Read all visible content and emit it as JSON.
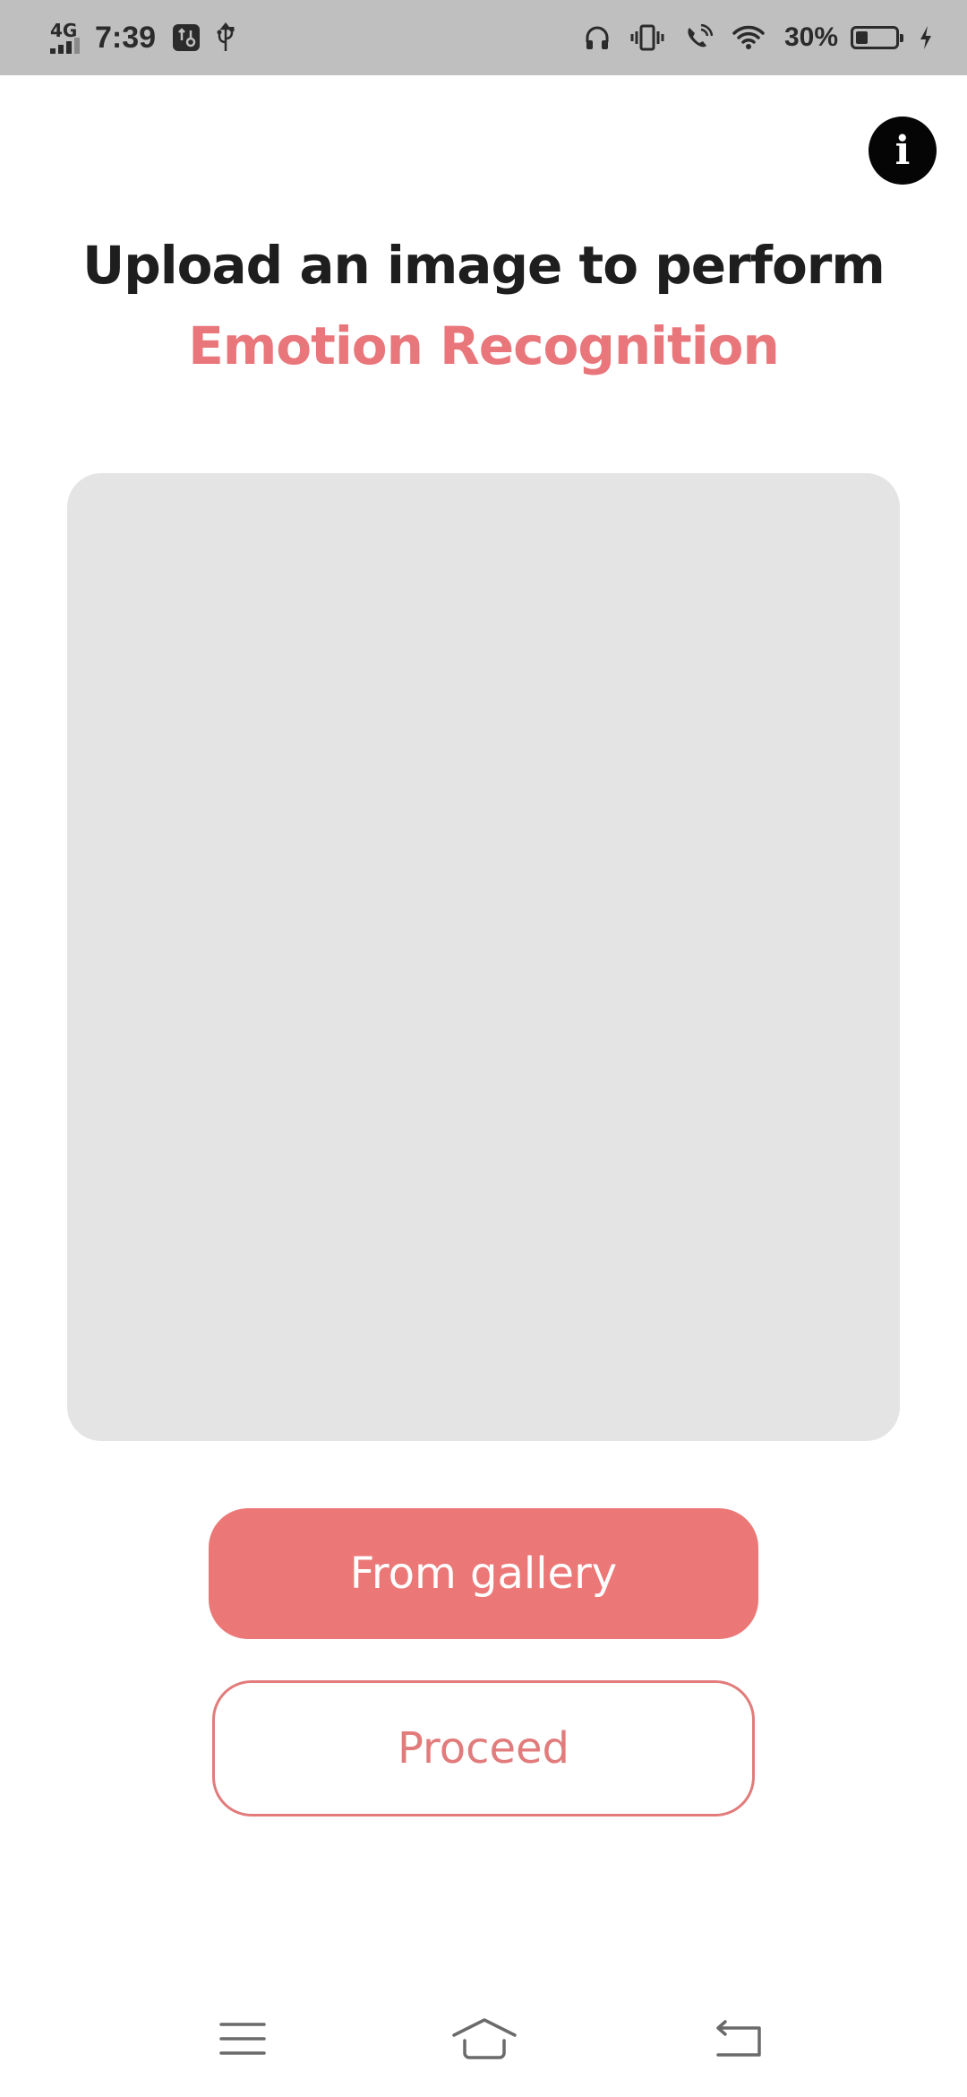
{
  "status_bar": {
    "network": "4G",
    "time": "7:39",
    "battery_percent": "30%",
    "battery_level": 0.3,
    "icons": [
      "signal-icon",
      "usb-debug-icon",
      "usb-icon",
      "headphones-icon",
      "vibrate-icon",
      "wifi-calling-icon",
      "wifi-icon",
      "battery-icon",
      "charging-icon"
    ]
  },
  "info_button": {
    "label": "i"
  },
  "heading": {
    "line1": "Upload an image to perform",
    "line2": "Emotion Recognition"
  },
  "buttons": {
    "gallery_label": "From gallery",
    "proceed_label": "Proceed"
  },
  "colors": {
    "accent": "#ec7777",
    "accent_text": "#e8767a",
    "preview_bg": "#e4e4e4",
    "status_bar_bg": "#bfbfbf"
  },
  "nav_bar": {
    "icons": [
      "menu-icon",
      "home-icon",
      "back-icon"
    ]
  }
}
